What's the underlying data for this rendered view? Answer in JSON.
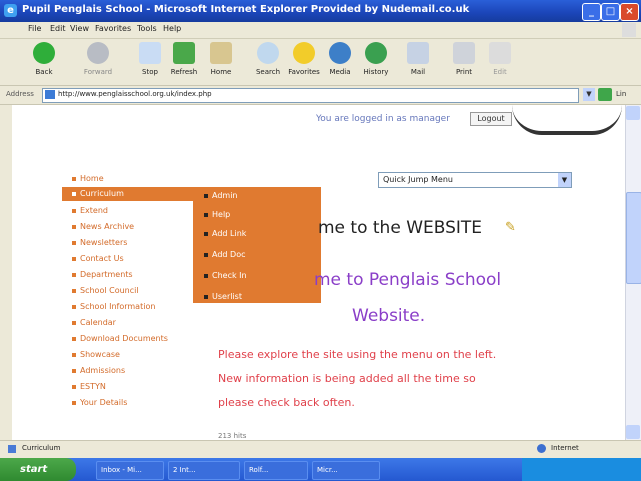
{
  "window": {
    "title": "Pupil Penglais School - Microsoft Internet Explorer Provided by Nudemail.co.uk",
    "controls": [
      "_",
      "□",
      "×"
    ]
  },
  "menubar": {
    "items": [
      "File",
      "Edit",
      "View",
      "Favorites",
      "Tools",
      "Help"
    ]
  },
  "toolbar": {
    "buttons": [
      {
        "label": "Back",
        "icon": "back-arrow-icon"
      },
      {
        "label": "Forward",
        "icon": "forward-arrow-icon"
      },
      {
        "label": "Stop",
        "icon": "stop-icon"
      },
      {
        "label": "Refresh",
        "icon": "refresh-icon"
      },
      {
        "label": "Home",
        "icon": "home-icon"
      },
      {
        "label": "Search",
        "icon": "search-icon"
      },
      {
        "label": "Favorites",
        "icon": "favorites-star-icon"
      },
      {
        "label": "Media",
        "icon": "media-icon"
      },
      {
        "label": "History",
        "icon": "history-icon"
      },
      {
        "label": "Mail",
        "icon": "mail-icon"
      },
      {
        "label": "Print",
        "icon": "print-icon"
      },
      {
        "label": "Edit",
        "icon": "edit-icon"
      }
    ]
  },
  "address": {
    "label": "Address",
    "url": "http://www.penglaisschool.org.uk/index.php",
    "links_label": "Lin"
  },
  "page": {
    "logged_in_text": "You are logged in as manager",
    "logout_label": "Logout",
    "quick_jump": "Quick Jump Menu",
    "nav": [
      "Home",
      "Curriculum",
      "Extend",
      "News Archive",
      "Newsletters",
      "Contact Us",
      "Departments",
      "School Council",
      "School Information",
      "Calendar",
      "Download Documents",
      "Showcase",
      "Admissions",
      "ESTYN",
      "Your Details"
    ],
    "active_nav_index": 1,
    "submenu": [
      "Admin",
      "Help",
      "Add Link",
      "Add Doc",
      "Check In",
      "Userlist"
    ],
    "welcome_line1": "me to the WEBSITE",
    "welcome_line2": "me to Penglais School",
    "welcome_line3": "Website.",
    "paragraph": [
      "Please explore the site using the menu on the left.",
      "New information is being added all the time so",
      "please check back often."
    ],
    "counter": "213 hits"
  },
  "statusbar": {
    "text": "Curriculum",
    "zone": "Internet"
  },
  "taskbar": {
    "start": "start",
    "tasks": [
      "Inbox - Mi...",
      "2 Int...",
      "Rolf...",
      "Micr..."
    ]
  },
  "colors": {
    "accent_orange": "#e07a30",
    "welcome_purple": "#8a3ec8",
    "text_red": "#e0404a",
    "xp_blue": "#2458d0"
  }
}
